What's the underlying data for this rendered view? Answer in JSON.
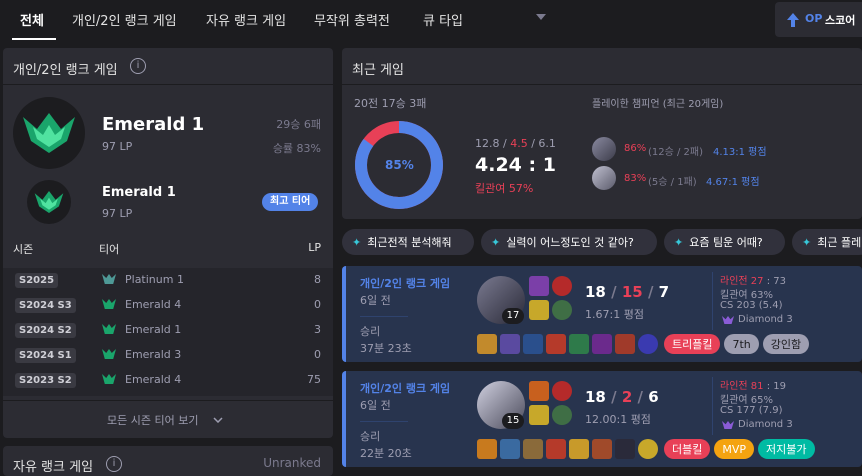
{
  "tabs": [
    "전체",
    "개인/2인 랭크 게임",
    "자유 랭크 게임",
    "무작위 총력전",
    "큐 타입"
  ],
  "op_button": {
    "icon": "arrow-up-icon",
    "label_prefix": "OP",
    "label": "스코어"
  },
  "ranked_solo": {
    "title": "개인/2인 랭크 게임",
    "current": {
      "tier": "Emerald 1",
      "lp": "97 LP",
      "record": "29승 6패",
      "winrate": "승률 83%"
    },
    "peak": {
      "tier": "Emerald 1",
      "lp": "97 LP",
      "badge": "최고 티어"
    },
    "season_headers": {
      "season": "시즌",
      "tier": "티어",
      "lp": "LP"
    },
    "seasons": [
      {
        "season": "S2025",
        "tier": "Platinum 1",
        "lp": "8"
      },
      {
        "season": "S2024 S3",
        "tier": "Emerald 4",
        "lp": "0"
      },
      {
        "season": "S2024 S2",
        "tier": "Emerald 1",
        "lp": "3"
      },
      {
        "season": "S2024 S1",
        "tier": "Emerald 3",
        "lp": "0"
      },
      {
        "season": "S2023 S2",
        "tier": "Emerald 4",
        "lp": "75"
      }
    ],
    "all_seasons_label": "모든 시즌 티어 보기"
  },
  "ranked_flex": {
    "title": "자유 랭크 게임",
    "status": "Unranked"
  },
  "recent": {
    "title": "최근 게임",
    "summary": "20전 17승 3패",
    "winrate_pct": "85%",
    "winrate_value": 85,
    "kda_k": "12.8",
    "kda_d": "4.5",
    "kda_a": "6.1",
    "kda_ratio": "4.24 : 1",
    "kill_participation": "킬관여 57%",
    "champions_title": "플레이한 챔피언 (최근 20게임)",
    "champions": [
      {
        "winrate": "86%",
        "record": "(12승 / 2패)",
        "kda": "4.13:1 평점"
      },
      {
        "winrate": "83%",
        "record": "(5승 / 1패)",
        "kda": "4.67:1 평점"
      }
    ]
  },
  "ai_pills": [
    "최근전적 분석해줘",
    "실력이 어느정도인 것 같아?",
    "요즘 팀운 어때?",
    "최근 플레"
  ],
  "games": [
    {
      "queue": "개인/2인 랭크 게임",
      "ago": "6일 전",
      "result": "승리",
      "duration": "37분 23초",
      "level": "17",
      "kills": "18",
      "deaths": "15",
      "assists": "7",
      "kda": "1.67:1 평점",
      "laning_label": "라인전",
      "laning_value": "27",
      "laning_rest": " : 73",
      "kp": "킬관여 63%",
      "cs": "CS 203 (5.4)",
      "avg_tier": "Diamond 3",
      "tags": [
        {
          "text": "트리플킬",
          "color": "#e84057"
        },
        {
          "text": "7th",
          "color": "#9e9eb1"
        },
        {
          "text": "강인함",
          "color": "#9e9eb1"
        }
      ]
    },
    {
      "queue": "개인/2인 랭크 게임",
      "ago": "6일 전",
      "result": "승리",
      "duration": "22분 20초",
      "level": "15",
      "kills": "18",
      "deaths": "2",
      "assists": "6",
      "kda": "12.00:1 평점",
      "laning_label": "라인전",
      "laning_value": "81",
      "laning_rest": " : 19",
      "kp": "킬관여 65%",
      "cs": "CS 177 (7.9)",
      "avg_tier": "Diamond 3",
      "tags": [
        {
          "text": "더블킬",
          "color": "#e84057"
        },
        {
          "text": "MVP",
          "color": "#f4a310"
        },
        {
          "text": "저지불가",
          "color": "#00bba3"
        }
      ]
    }
  ]
}
